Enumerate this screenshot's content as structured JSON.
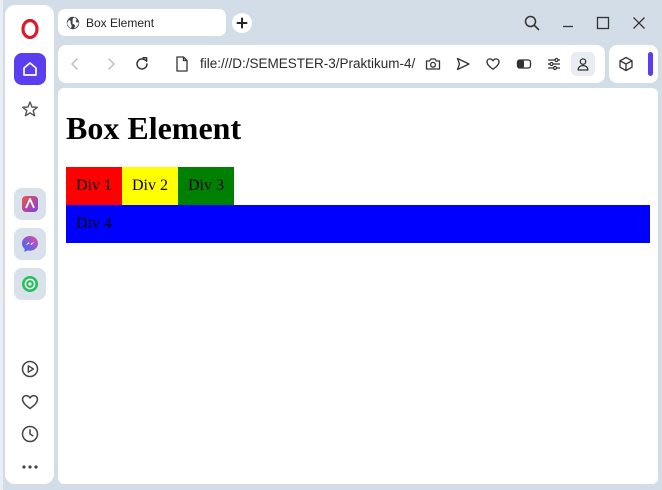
{
  "tab": {
    "title": "Box Element"
  },
  "addressbar": {
    "url": "file:///D:/SEMESTER-3/Praktikum-4/"
  },
  "page": {
    "heading": "Box Element",
    "boxes": [
      {
        "label": "Div 1",
        "color": "#ff0000"
      },
      {
        "label": "Div 2",
        "color": "#ffff00"
      },
      {
        "label": "Div 3",
        "color": "#008000"
      },
      {
        "label": "Div 4",
        "color": "#0000ff"
      }
    ]
  },
  "theme": {
    "accent": "#5b3ef0",
    "opera_red": "#e0192a",
    "chrome_bg": "#d3dde8"
  },
  "icons": {
    "sidebar": [
      "opera-logo-icon",
      "home-icon",
      "star-icon",
      "aria-icon",
      "messenger-icon",
      "whatsapp-icon",
      "player-icon",
      "heart-icon",
      "history-icon",
      "more-icon"
    ],
    "toolbar": [
      "back-icon",
      "forward-icon",
      "reload-icon",
      "page-icon",
      "camera-icon",
      "send-icon",
      "heart-icon",
      "battery-icon",
      "settings-icon",
      "profile-icon",
      "extensions-cube-icon"
    ],
    "window": [
      "search-tabs-icon",
      "minimize-icon",
      "maximize-icon",
      "close-icon"
    ]
  }
}
